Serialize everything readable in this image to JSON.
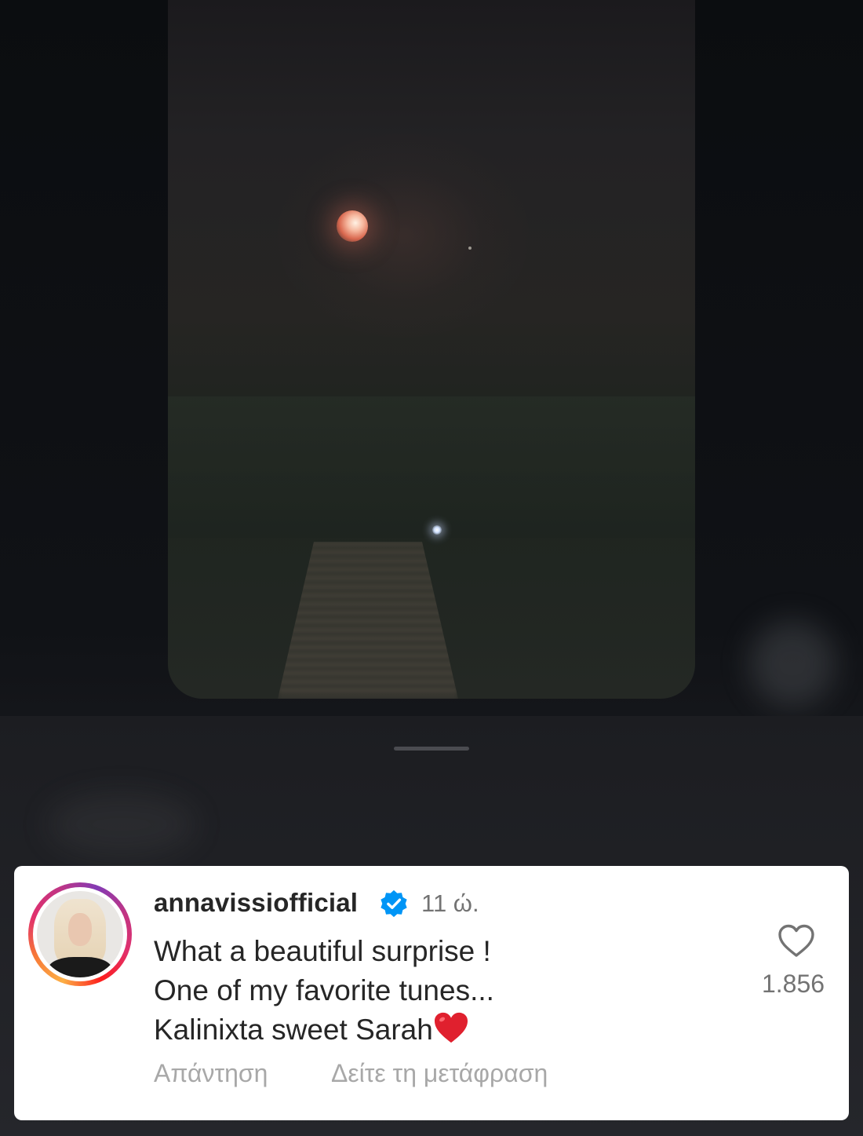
{
  "comment": {
    "username": "annavissiofficial",
    "verified": true,
    "timestamp": "11 ώ.",
    "lines": [
      "What a beautiful surprise !",
      "One of my favorite tunes...",
      "Kalinixta sweet Sarah"
    ],
    "emoji": "red-heart",
    "reply_label": "Απάντηση",
    "translate_label": "Δείτε τη μετάφραση",
    "like_count": "1.856"
  },
  "colors": {
    "verified_badge": "#0095f6",
    "text_primary": "#262626",
    "text_secondary": "#737373",
    "text_tertiary": "#a8a8a8"
  },
  "icons": {
    "like": "heart-outline-icon",
    "verified": "verified-badge-icon",
    "emoji": "red-heart-emoji-icon"
  }
}
